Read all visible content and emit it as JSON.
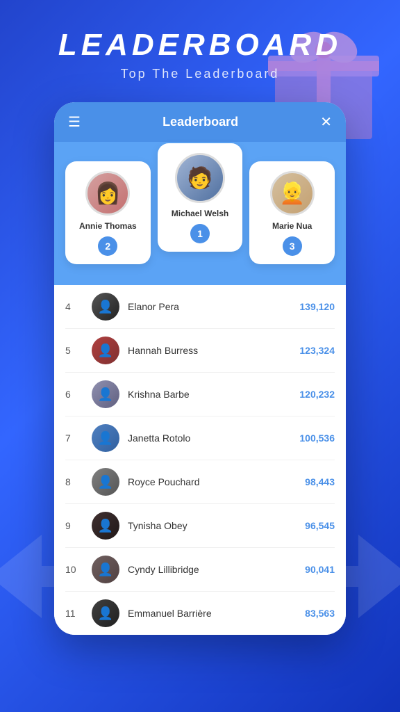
{
  "header": {
    "title": "LEADERBOARD",
    "subtitle": "Top The Leaderboard"
  },
  "app_bar": {
    "title": "Leaderboard",
    "menu_label": "☰",
    "close_label": "✕"
  },
  "top3": [
    {
      "rank": 2,
      "name": "Annie Thomas",
      "avatar_emoji": "👩",
      "avatar_class": "avatar-annie",
      "position": "second"
    },
    {
      "rank": 1,
      "name": "Michael Welsh",
      "avatar_emoji": "👨",
      "avatar_class": "avatar-michael",
      "position": "first"
    },
    {
      "rank": 3,
      "name": "Marie Nua",
      "avatar_emoji": "👩",
      "avatar_class": "avatar-marie",
      "position": "third"
    }
  ],
  "list": [
    {
      "rank": 4,
      "name": "Elanor Pera",
      "score": "139,120",
      "av_class": "av1"
    },
    {
      "rank": 5,
      "name": "Hannah Burress",
      "score": "123,324",
      "av_class": "av2"
    },
    {
      "rank": 6,
      "name": "Krishna Barbe",
      "score": "120,232",
      "av_class": "av3"
    },
    {
      "rank": 7,
      "name": "Janetta Rotolo",
      "score": "100,536",
      "av_class": "av4"
    },
    {
      "rank": 8,
      "name": "Royce Pouchard",
      "score": "98,443",
      "av_class": "av5"
    },
    {
      "rank": 9,
      "name": "Tynisha Obey",
      "score": "96,545",
      "av_class": "av6"
    },
    {
      "rank": 10,
      "name": "Cyndy Lillibridge",
      "score": "90,041",
      "av_class": "av7"
    },
    {
      "rank": 11,
      "name": "Emmanuel Barrière",
      "score": "83,563",
      "av_class": "av8"
    }
  ]
}
